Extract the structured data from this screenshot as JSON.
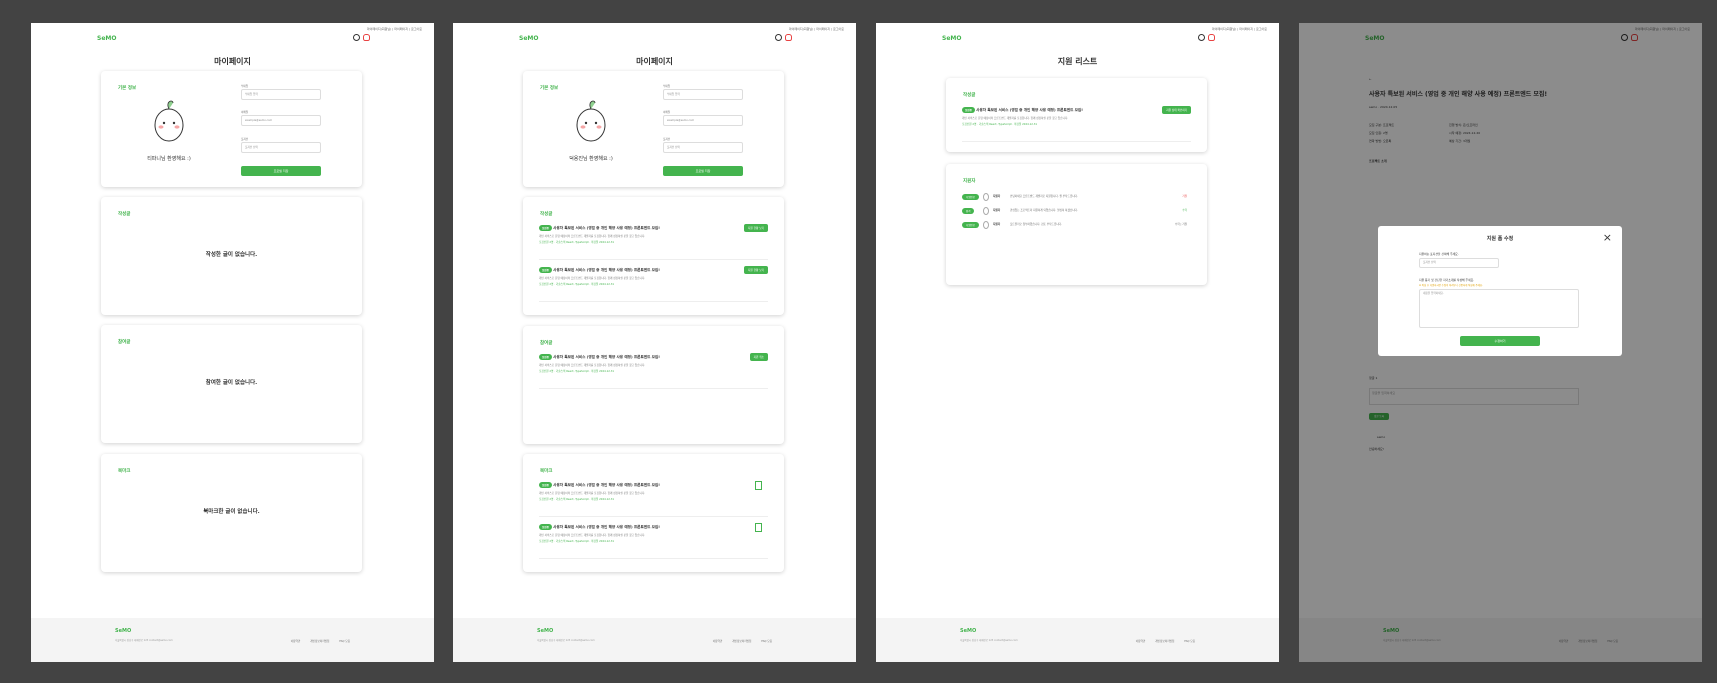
{
  "brand": {
    "logo": "SeMO",
    "accent": "#44b44e"
  },
  "topnav": "마이페이지(회원님) | 마이페이지 | 로그아웃",
  "mypage": {
    "title": "마이페이지",
    "basic_info": "기본 정보",
    "nickname_label": "닉네임",
    "nickname_value": "닉네임 입력",
    "email_label": "이메일",
    "email_value": "example@semo.com",
    "role_label": "포지션",
    "role_value": "포지션 선택",
    "save_button": "프로필 저장",
    "welcome1": "티파니님 환영해요 :)",
    "welcome2": "덕용진님 환영해요 :)",
    "written_section": "작성글",
    "written_empty": "작성한 글이 없습니다.",
    "joined_section": "참여글",
    "joined_empty": "참여한 글이 없습니다.",
    "bookmark_section": "북마크",
    "bookmark_empty": "북마크한 글이 없습니다."
  },
  "post": {
    "badge": "모집중",
    "title": "사용자 특보된 서비스 (영업 중 개인 해양 사용 예정) 프론트엔드 모집!",
    "desc": "개인 서비스로 운영 예정이며 프론트엔드 개발자를 모집합니다. 함께 성장하실 분을 찾고 있습니다.",
    "meta": "모집인원 2명 · 기술스택 React, TypeScript · 마감일 2024.12.31",
    "status_button": "지원 현황 보기",
    "joined_button": "지원 취소"
  },
  "applylist": {
    "title": "지원 리스트",
    "written_section": "작성글",
    "applicant_section": "지원자",
    "status_button": "지원 상태 확인하기",
    "applicants": [
      {
        "badge": "지원완료",
        "name": "지원자",
        "text": "안녕하세요 프론트엔드 개발자로 지원합니다. 잘 부탁드립니다.",
        "status": "거절",
        "color": "#e84242"
      },
      {
        "badge": "합격",
        "name": "지원자",
        "text": "관심있는 프로젝트라 지원하게 되었습니다. 열심히 하겠습니다.",
        "status": "수락",
        "color": "#44b44e"
      },
      {
        "badge": "지원완료",
        "name": "지원자",
        "text": "포트폴리오 첨부하였습니다. 검토 부탁드립니다.",
        "status": "수락 | 거절",
        "color": "#666666"
      }
    ]
  },
  "detail": {
    "title": "사용자 특보된 서비스 (영업 중 개인 해양 사용 예정) 프론트엔드 모집!",
    "author": "semo",
    "date": "2024.12.05",
    "info": [
      "모집 구분: 프로젝트",
      "모집 인원: 2명",
      "진행 방식: 온/오프라인",
      "시작 예정: 2024.12.20",
      "연락 방법: 오픈톡",
      "예상 기간: 3개월"
    ],
    "intro_heading": "프로젝트 소개",
    "comment_label": "댓글 1",
    "comment_placeholder": "댓글을 입력하세요",
    "comment_button": "댓글 등록",
    "commenter": "semo",
    "comment_text": "안녕하세요!"
  },
  "modal": {
    "title": "지원 폼 수정",
    "q1": "지원하는 포지션을 선택해 주세요.",
    "select_placeholder": "포지션 선택",
    "q2": "지원 동기 및 간단한 자기소개를 작성해 주세요.",
    "note": "※ 작성 후 지원하시면 수정이 어려우니 신중하게 작성해 주세요.",
    "textarea_placeholder": "내용을 입력하세요.",
    "submit": "수정하기"
  },
  "footer": {
    "logo": "SeMO",
    "address": "서울특별시 강남구 테헤란로 123 contact@semo.com",
    "links": [
      "이용약관",
      "개인정보처리방침",
      "FAQ 모음"
    ]
  }
}
